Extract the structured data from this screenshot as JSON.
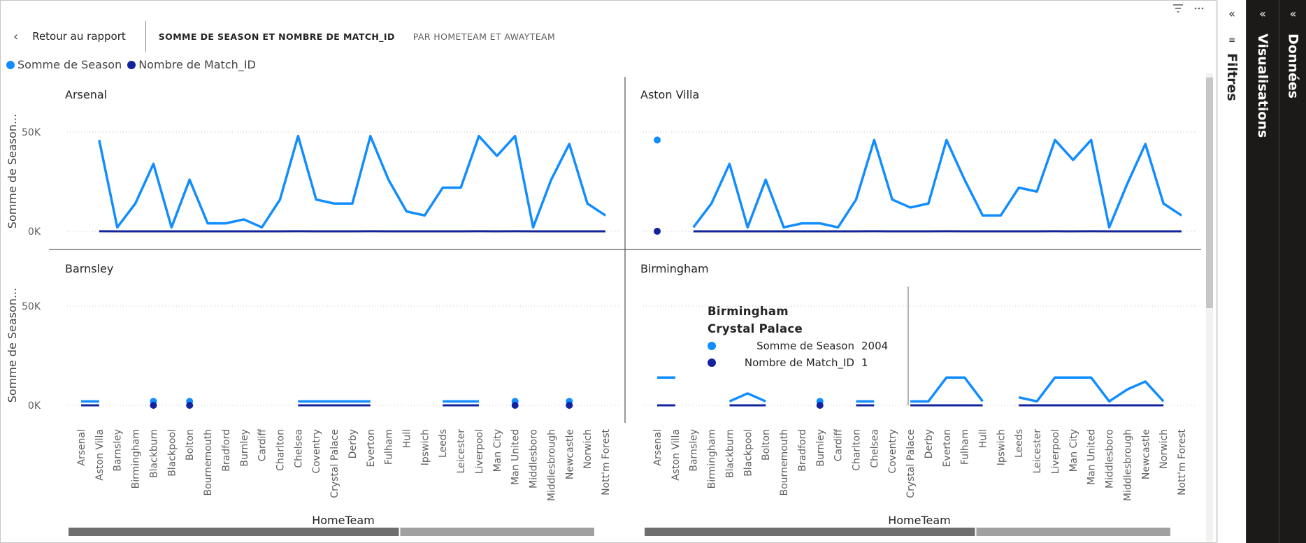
{
  "header": {
    "back_label": "Retour au rapport",
    "tabs": [
      {
        "label": "SOMME DE SEASON ET NOMBRE DE MATCH_ID",
        "active": true
      },
      {
        "label": "PAR HOMETEAM ET AWAYTEAM",
        "active": false
      }
    ],
    "icons": [
      "filter-icon",
      "more-options-icon"
    ]
  },
  "legend": [
    {
      "label": "Somme de Season",
      "color": "#118DFF"
    },
    {
      "label": "Nombre de Match_ID",
      "color": "#12239E"
    }
  ],
  "panes": {
    "filters": "Filtres",
    "visualisations": "Visualisations",
    "donnees": "Données"
  },
  "tooltip": {
    "title": "Birmingham",
    "subtitle": "Crystal Palace",
    "rows": [
      {
        "label": "Somme de Season",
        "value": "2004",
        "color": "#118DFF"
      },
      {
        "label": "Nombre de Match_ID",
        "value": "1",
        "color": "#12239E"
      }
    ]
  },
  "chart_data": {
    "type": "line",
    "layout": "small-multiples",
    "ylabel": "Somme de Season...",
    "xlabel": "HomeTeam",
    "ylim": [
      0,
      50000
    ],
    "yticks": [
      "0K",
      "50K"
    ],
    "categories": [
      "Arsenal",
      "Aston Villa",
      "Barnsley",
      "Birmingham",
      "Blackburn",
      "Blackpool",
      "Bolton",
      "Bournemouth",
      "Bradford",
      "Burnley",
      "Cardiff",
      "Charlton",
      "Chelsea",
      "Coventry",
      "Crystal Palace",
      "Derby",
      "Everton",
      "Fulham",
      "Hull",
      "Ipswich",
      "Leeds",
      "Leicester",
      "Liverpool",
      "Man City",
      "Man United",
      "Middlesboro",
      "Middlesbrough",
      "Newcastle",
      "Norwich",
      "Nott'm Forest"
    ],
    "panels": [
      {
        "title": "Arsenal",
        "series": [
          {
            "name": "Somme de Season",
            "values": [
              null,
              46000,
              2000,
              14000,
              34000,
              2000,
              26000,
              4000,
              4000,
              6000,
              2000,
              16000,
              48000,
              16000,
              14000,
              14000,
              48000,
              26000,
              10000,
              8000,
              22000,
              22000,
              48000,
              38000,
              48000,
              2000,
              26000,
              44000,
              14000,
              8000
            ]
          },
          {
            "name": "Nombre de Match_ID",
            "values": [
              null,
              23,
              1,
              7,
              17,
              1,
              13,
              2,
              2,
              3,
              1,
              8,
              24,
              8,
              7,
              7,
              24,
              13,
              5,
              4,
              11,
              11,
              24,
              19,
              24,
              1,
              13,
              22,
              7,
              4
            ]
          }
        ]
      },
      {
        "title": "Aston Villa",
        "series": [
          {
            "name": "Somme de Season",
            "values": [
              46000,
              null,
              2000,
              14000,
              34000,
              2000,
              26000,
              2000,
              4000,
              4000,
              2000,
              16000,
              46000,
              16000,
              12000,
              14000,
              46000,
              26000,
              8000,
              8000,
              22000,
              20000,
              46000,
              36000,
              46000,
              2000,
              24000,
              44000,
              14000,
              8000
            ]
          },
          {
            "name": "Nombre de Match_ID",
            "values": [
              23,
              null,
              1,
              7,
              17,
              1,
              13,
              1,
              2,
              2,
              1,
              8,
              23,
              8,
              6,
              7,
              23,
              13,
              4,
              4,
              11,
              10,
              23,
              18,
              23,
              1,
              12,
              22,
              7,
              4
            ]
          }
        ]
      },
      {
        "title": "Barnsley",
        "series": [
          {
            "name": "Somme de Season",
            "values": [
              2000,
              2000,
              null,
              null,
              2000,
              null,
              2000,
              null,
              null,
              null,
              null,
              null,
              2000,
              2000,
              2000,
              2000,
              2000,
              null,
              null,
              null,
              2000,
              2000,
              2000,
              null,
              2000,
              null,
              null,
              2000,
              null,
              null
            ]
          },
          {
            "name": "Nombre de Match_ID",
            "values": [
              1,
              1,
              null,
              null,
              1,
              null,
              1,
              null,
              null,
              null,
              null,
              null,
              1,
              1,
              1,
              1,
              1,
              null,
              null,
              null,
              1,
              1,
              1,
              null,
              1,
              null,
              null,
              1,
              null,
              null
            ]
          }
        ]
      },
      {
        "title": "Birmingham",
        "series": [
          {
            "name": "Somme de Season",
            "values": [
              14000,
              14000,
              null,
              null,
              2000,
              6000,
              2000,
              null,
              null,
              2000,
              null,
              2000,
              2000,
              null,
              2000,
              2000,
              14000,
              14000,
              2000,
              null,
              4000,
              2000,
              14000,
              14000,
              14000,
              2000,
              8000,
              12000,
              2000,
              null
            ]
          },
          {
            "name": "Nombre de Match_ID",
            "values": [
              7,
              7,
              null,
              null,
              1,
              3,
              1,
              null,
              null,
              1,
              null,
              1,
              1,
              null,
              1,
              1,
              7,
              7,
              1,
              null,
              2,
              1,
              7,
              7,
              7,
              1,
              4,
              6,
              1,
              null
            ]
          }
        ]
      }
    ]
  }
}
